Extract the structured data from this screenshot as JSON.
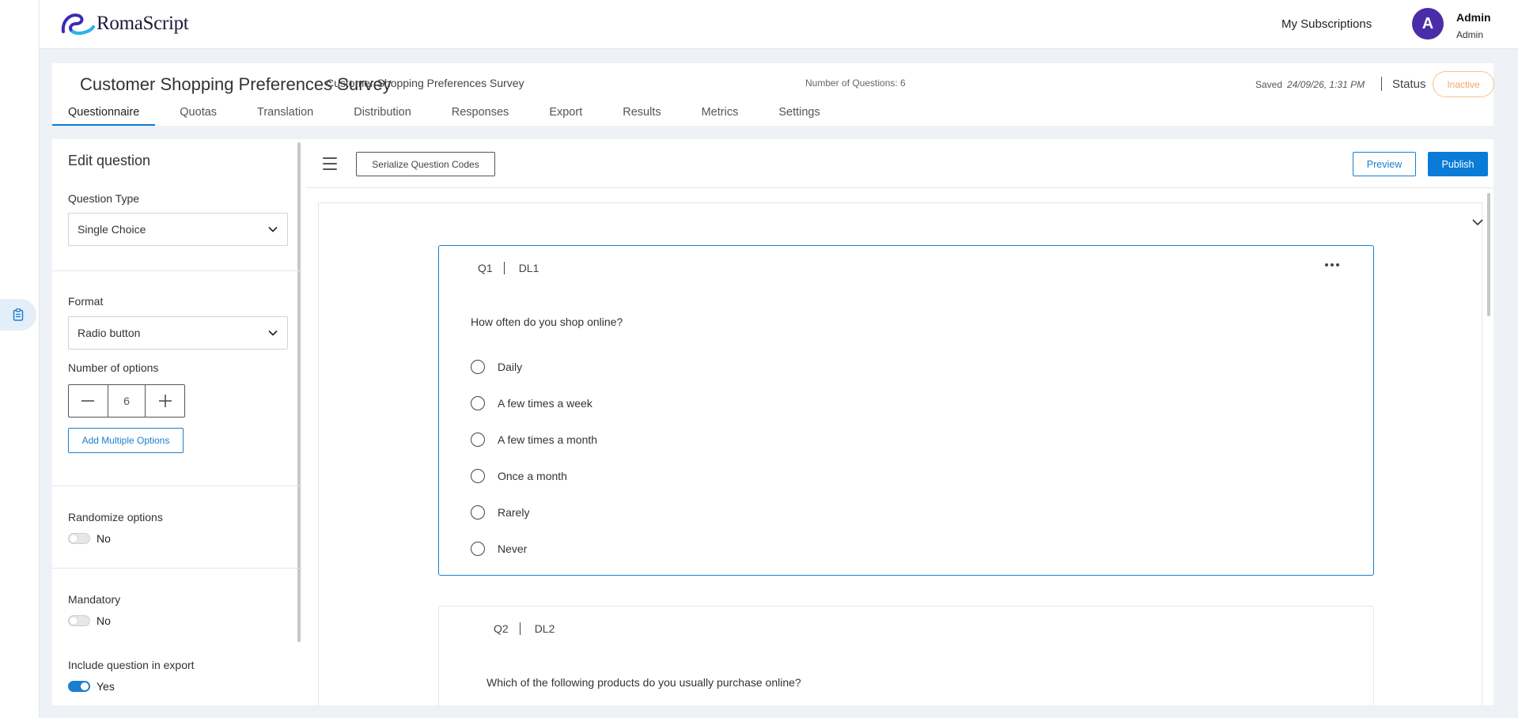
{
  "app": {
    "logo_text": "RomaScript",
    "my_subscriptions": "My Subscriptions",
    "user": {
      "initial": "A",
      "name": "Admin",
      "role": "Admin"
    }
  },
  "survey": {
    "title": "Customer Shopping Preferences Survey",
    "saved_label": "Saved",
    "saved_date": "24/09/26, 1:31 PM",
    "status_label": "Status",
    "status_value": "Inactive",
    "tabs": [
      {
        "label": "Questionnaire",
        "active": true
      },
      {
        "label": "Quotas"
      },
      {
        "label": "Translation"
      },
      {
        "label": "Distribution"
      },
      {
        "label": "Responses"
      },
      {
        "label": "Export"
      },
      {
        "label": "Results"
      },
      {
        "label": "Metrics"
      },
      {
        "label": "Settings"
      }
    ]
  },
  "edit_panel": {
    "title": "Edit question",
    "question_type_label": "Question Type",
    "question_type_value": "Single Choice",
    "format_label": "Format",
    "format_value": "Radio button",
    "num_options_label": "Number of options",
    "num_options_value": "6",
    "add_multiple_label": "Add Multiple Options",
    "randomize_label": "Randomize options",
    "randomize_value": "No",
    "mandatory_label": "Mandatory",
    "mandatory_value": "No",
    "include_export_label": "Include question in export",
    "include_export_value": "Yes"
  },
  "toolbar": {
    "serialize_label": "Serialize Question Codes",
    "preview_label": "Preview",
    "publish_label": "Publish"
  },
  "block": {
    "title": "Customer Shopping Preferences Survey",
    "num_questions": "Number of Questions: 6"
  },
  "questions": [
    {
      "code": "Q1",
      "label": "DL1",
      "text": "How often do you shop online?",
      "options": [
        "Daily",
        "A few times a week",
        "A few times a month",
        "Once a month",
        "Rarely",
        "Never"
      ]
    },
    {
      "code": "Q2",
      "label": "DL2",
      "text": "Which of the following products do you usually purchase online?"
    }
  ],
  "colors": {
    "accent": "#0a7bd7",
    "avatar": "#4a2ca8",
    "inactive": "#f0a860"
  }
}
